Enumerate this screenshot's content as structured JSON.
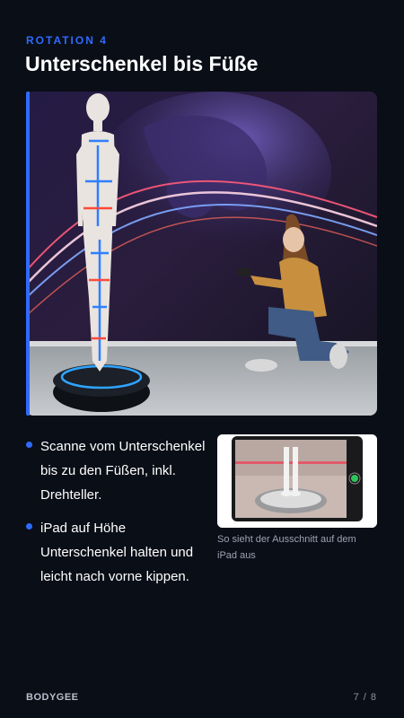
{
  "header": {
    "eyebrow": "ROTATION 4",
    "title": "Unterschenkel bis Füße"
  },
  "bullets": [
    "Scanne vom Unterschenkel bis zu den Füßen, inkl. Drehteller.",
    "iPad auf Höhe Unterschenkel halten und leicht nach vorne kippen."
  ],
  "thumbnail": {
    "caption": "So sieht der Ausschnitt auf dem iPad aus"
  },
  "footer": {
    "brand": "BODYGEE",
    "page": "7 / 8"
  },
  "colors": {
    "accent": "#2f6bff",
    "background": "#0a0e17"
  }
}
